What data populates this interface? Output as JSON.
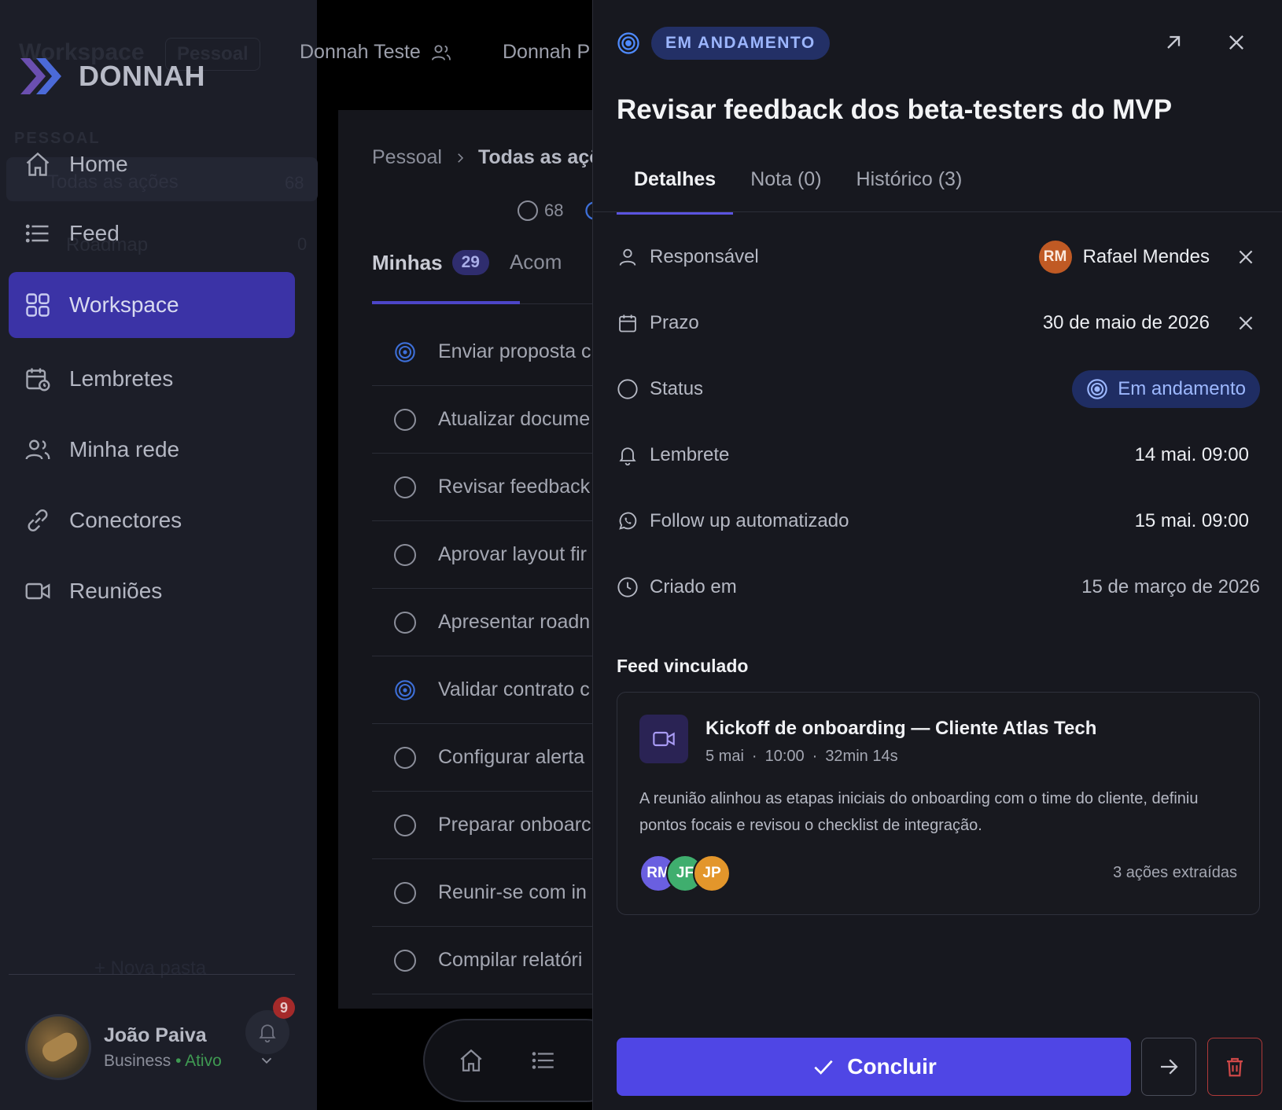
{
  "sidebar": {
    "ghost_workspace": "Workspace",
    "ghost_pessoal": "Pessoal",
    "ghost_section": "PESSOAL",
    "ghost_all": "Todas as ações",
    "ghost_all_count": "68",
    "ghost_roadmap": "Roadmap",
    "ghost_roadmap_count": "0",
    "ghost_new_folder": "+ Nova pasta",
    "brand": "DONNAH",
    "items": [
      {
        "label": "Home",
        "icon": "home-icon"
      },
      {
        "label": "Feed",
        "icon": "list-icon"
      },
      {
        "label": "Workspace",
        "icon": "grid-icon",
        "active": true
      },
      {
        "label": "Lembretes",
        "icon": "calendar-clock-icon"
      },
      {
        "label": "Minha rede",
        "icon": "users-icon"
      },
      {
        "label": "Conectores",
        "icon": "link-icon"
      },
      {
        "label": "Reuniões",
        "icon": "video-icon"
      }
    ],
    "user": {
      "name": "João Paiva",
      "plan": "Business",
      "state": "Ativo",
      "notifications": "9"
    }
  },
  "topbar": {
    "tab1": "Donnah Teste",
    "tab2": "Donnah P"
  },
  "main": {
    "crumb_root": "Pessoal",
    "crumb_current": "Todas as açõ",
    "count_open": "68",
    "tab_mine": "Minhas",
    "tab_mine_count": "29",
    "tab_follow": "Acom",
    "rows": [
      {
        "text": "Enviar proposta c",
        "status": "in-progress"
      },
      {
        "text": "Atualizar docume",
        "status": "open"
      },
      {
        "text": "Revisar feedback",
        "status": "open"
      },
      {
        "text": "Aprovar layout fir",
        "status": "open"
      },
      {
        "text": "Apresentar roadn",
        "status": "open"
      },
      {
        "text": "Validar contrato c",
        "status": "in-progress"
      },
      {
        "text": "Configurar alerta",
        "status": "open"
      },
      {
        "text": "Preparar onboarc",
        "status": "open"
      },
      {
        "text": "Reunir-se com in",
        "status": "open"
      },
      {
        "text": "Compilar relatóri",
        "status": "open"
      }
    ]
  },
  "drawer": {
    "status_chip": "EM ANDAMENTO",
    "title": "Revisar feedback dos beta-testers do MVP",
    "tabs": [
      "Detalhes",
      "Nota (0)",
      "Histórico (3)"
    ],
    "props": {
      "responsavel": {
        "label": "Responsável",
        "initials": "RM",
        "value": "Rafael Mendes"
      },
      "prazo": {
        "label": "Prazo",
        "value": "30 de maio de 2026"
      },
      "status": {
        "label": "Status",
        "value": "Em andamento"
      },
      "lembrete": {
        "label": "Lembrete",
        "value": "14 mai. 09:00"
      },
      "followup": {
        "label": "Follow up automatizado",
        "value": "15 mai. 09:00"
      },
      "criado": {
        "label": "Criado em",
        "value": "15 de março de 2026"
      }
    },
    "feed": {
      "heading": "Feed vinculado",
      "title": "Kickoff de onboarding — Cliente Atlas Tech",
      "date": "5 mai",
      "time": "10:00",
      "duration": "32min 14s",
      "sep": "·",
      "summary": "A reunião alinhou as etapas iniciais do onboarding com o time do cliente, definiu pontos focais e revisou o checklist de integração.",
      "participants": [
        {
          "initials": "RM",
          "color": "#6a5fe0"
        },
        {
          "initials": "JF",
          "color": "#3fae6e"
        },
        {
          "initials": "JP",
          "color": "#e3962b"
        }
      ],
      "count": "3 ações extraídas"
    },
    "primary_label": "Concluir"
  },
  "colors": {
    "accent": "#4f46e5",
    "status_blue": "#9db8ff",
    "danger": "#b03a3a"
  }
}
